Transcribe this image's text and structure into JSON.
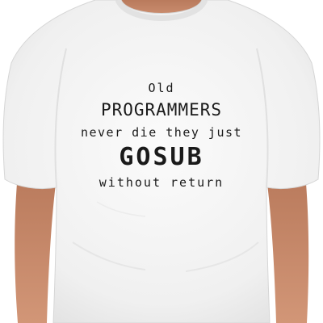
{
  "shirt": {
    "color": "#f6f6f6",
    "shadow_color": "#dcdcdc",
    "print_color": "#1a1a1a"
  },
  "skin": {
    "color": "#c98a6a"
  },
  "print": {
    "line1": "Old",
    "line2": "PROGRAMMERS",
    "line3": "never die they just",
    "line4": "GOSUB",
    "line5": "without return"
  }
}
